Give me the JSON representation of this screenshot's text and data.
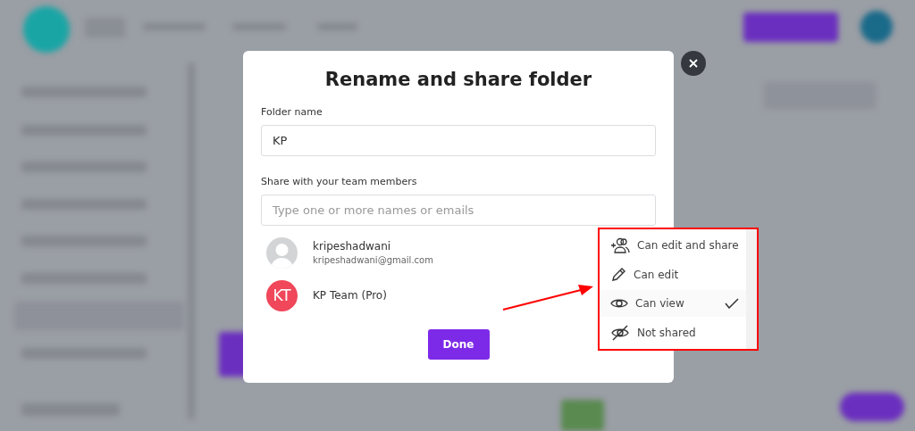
{
  "dialog": {
    "title": "Rename and share folder",
    "folder_name": {
      "label": "Folder name",
      "value": "KP"
    },
    "share": {
      "label": "Share with your team members",
      "placeholder": "Type one or more names or emails"
    },
    "members": [
      {
        "kind": "photo",
        "name": "kripeshadwani",
        "email": "kripeshadwani@gmail.com"
      },
      {
        "kind": "initials",
        "initials": "KT",
        "name": "KP Team (Pro)",
        "color": "#f0475a"
      }
    ],
    "done_button": "Done"
  },
  "permission_menu": {
    "items": [
      {
        "kind": "share",
        "label": "Can edit and share",
        "selected": false
      },
      {
        "kind": "edit",
        "label": "Can edit",
        "selected": false
      },
      {
        "kind": "view",
        "label": "Can view",
        "selected": true
      },
      {
        "kind": "hidden",
        "label": "Not shared",
        "selected": false
      }
    ]
  }
}
